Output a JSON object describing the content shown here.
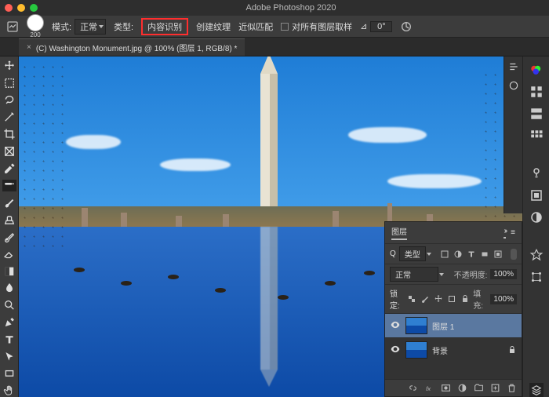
{
  "app": {
    "title": "Adobe Photoshop 2020"
  },
  "options_bar": {
    "brush_size": "200",
    "mode_label": "模式:",
    "mode_value": "正常",
    "type_label": "类型:",
    "content_aware": "内容识别",
    "create_texture": "创建纹理",
    "proximity_match": "近似匹配",
    "sample_all_layers": "对所有图层取样",
    "angle_symbol": "⊿",
    "angle_value": "0°"
  },
  "document_tab": {
    "title": "(C) Washington Monument.jpg @ 100% (图层 1, RGB/8) *"
  },
  "layers": {
    "panel_title": "图层",
    "kind_search": "类型",
    "blend_mode": "正常",
    "opacity_label": "不透明度:",
    "opacity_value": "100%",
    "lock_label": "锁定:",
    "fill_label": "填充:",
    "fill_value": "100%",
    "items": [
      {
        "name": "图层 1",
        "visible": true,
        "active": true,
        "locked": false
      },
      {
        "name": "背景",
        "visible": true,
        "active": false,
        "locked": true
      }
    ]
  },
  "icons": {
    "search": "Q",
    "menu": "≡"
  },
  "chart_data": null
}
